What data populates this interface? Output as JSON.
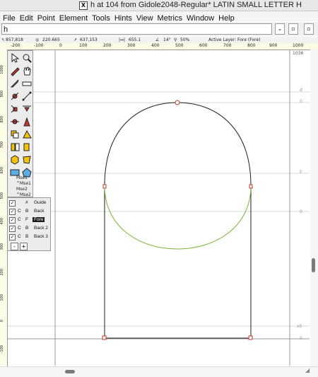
{
  "window": {
    "title": "h at 104 from Gidole2048-Regular* LATIN SMALL LETTER H"
  },
  "menu": [
    "File",
    "Edit",
    "Point",
    "Element",
    "Tools",
    "Hints",
    "View",
    "Metrics",
    "Window",
    "Help"
  ],
  "glyph_field": {
    "value": "h"
  },
  "selectors": {
    "a": "⌄",
    "b": "▫",
    "c": "▫"
  },
  "info": {
    "pos": "857,818",
    "dist": "220.665",
    "delta": "637,153",
    "len": "655.1",
    "angle": "14°",
    "zoom": "50%",
    "active_layer": "Active Layer: Fore (Fore)"
  },
  "ruler_h": [
    "-200",
    "-100",
    "0",
    "100",
    "200",
    "300",
    "400",
    "500",
    "600",
    "700",
    "800",
    "900",
    "1000"
  ],
  "ruler_v": [
    "1000",
    "900",
    "800",
    "700",
    "600",
    "500",
    "400",
    "300",
    "200",
    "100",
    "0",
    "-100"
  ],
  "guide_labels": {
    "top": "1036",
    "a": "d",
    "b": "0",
    "c": "E",
    "d": "0",
    "e": "x0",
    "f": "0"
  },
  "toolbox": {
    "mouse": [
      "Mse1",
      "^Mse1",
      "Mse2",
      "^Mse2"
    ]
  },
  "layers": {
    "rows": [
      {
        "checked": "✓",
        "q": "",
        "f": "#",
        "name": "Guide",
        "active": false
      },
      {
        "checked": "✓",
        "q": "C",
        "f": "B",
        "name": "Back",
        "active": false
      },
      {
        "checked": "✓",
        "q": "C",
        "f": "F",
        "name": "Fore",
        "active": true
      },
      {
        "checked": "✓",
        "q": "C",
        "f": "B",
        "name": "Back 2",
        "active": false
      },
      {
        "checked": "✓",
        "q": "C",
        "f": "B",
        "name": "Back 3",
        "active": false
      }
    ],
    "remove": "-",
    "add": "+"
  },
  "colors": {
    "curve_top": "#1f1f1f",
    "curve_bottom": "#7ab53a",
    "point": "#c0392b",
    "guide": "#d8d8d8"
  }
}
